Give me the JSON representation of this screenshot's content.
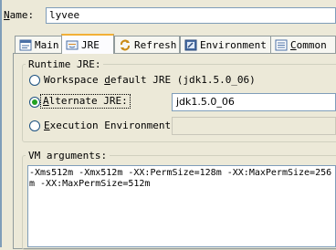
{
  "name_field": {
    "label_prefix": "N",
    "label_rest": "ame:",
    "value": "lyvee"
  },
  "tabs": [
    {
      "label": "Main",
      "icon": "main-tab-icon",
      "selected": false
    },
    {
      "label": "JRE",
      "icon": "jre-tab-icon",
      "selected": true
    },
    {
      "label": "Refresh",
      "icon": "refresh-tab-icon",
      "selected": false
    },
    {
      "label": "Environment",
      "icon": "environment-tab-icon",
      "selected": false
    },
    {
      "label_prefix": "C",
      "label_rest": "ommon",
      "icon": "common-tab-icon",
      "selected": false
    }
  ],
  "runtime_jre": {
    "title": "Runtime JRE:",
    "workspace_default": {
      "prefix": "Workspace ",
      "u": "d",
      "rest": "efault JRE (jdk1.5.0_06)",
      "selected": false
    },
    "alternate": {
      "prefix": "",
      "u": "A",
      "rest": "lternate JRE:",
      "selected": true,
      "value": "jdk1.5.0_06"
    },
    "execution_env": {
      "prefix": "",
      "u": "E",
      "rest": "xecution Environment:",
      "selected": false,
      "value": ""
    }
  },
  "vm_arguments": {
    "title": "VM arguments:",
    "value": "-Xms512m -Xmx512m -XX:PermSize=128m -XX:MaxPermSize=256m -XX:MaxPermSize=512m"
  }
}
